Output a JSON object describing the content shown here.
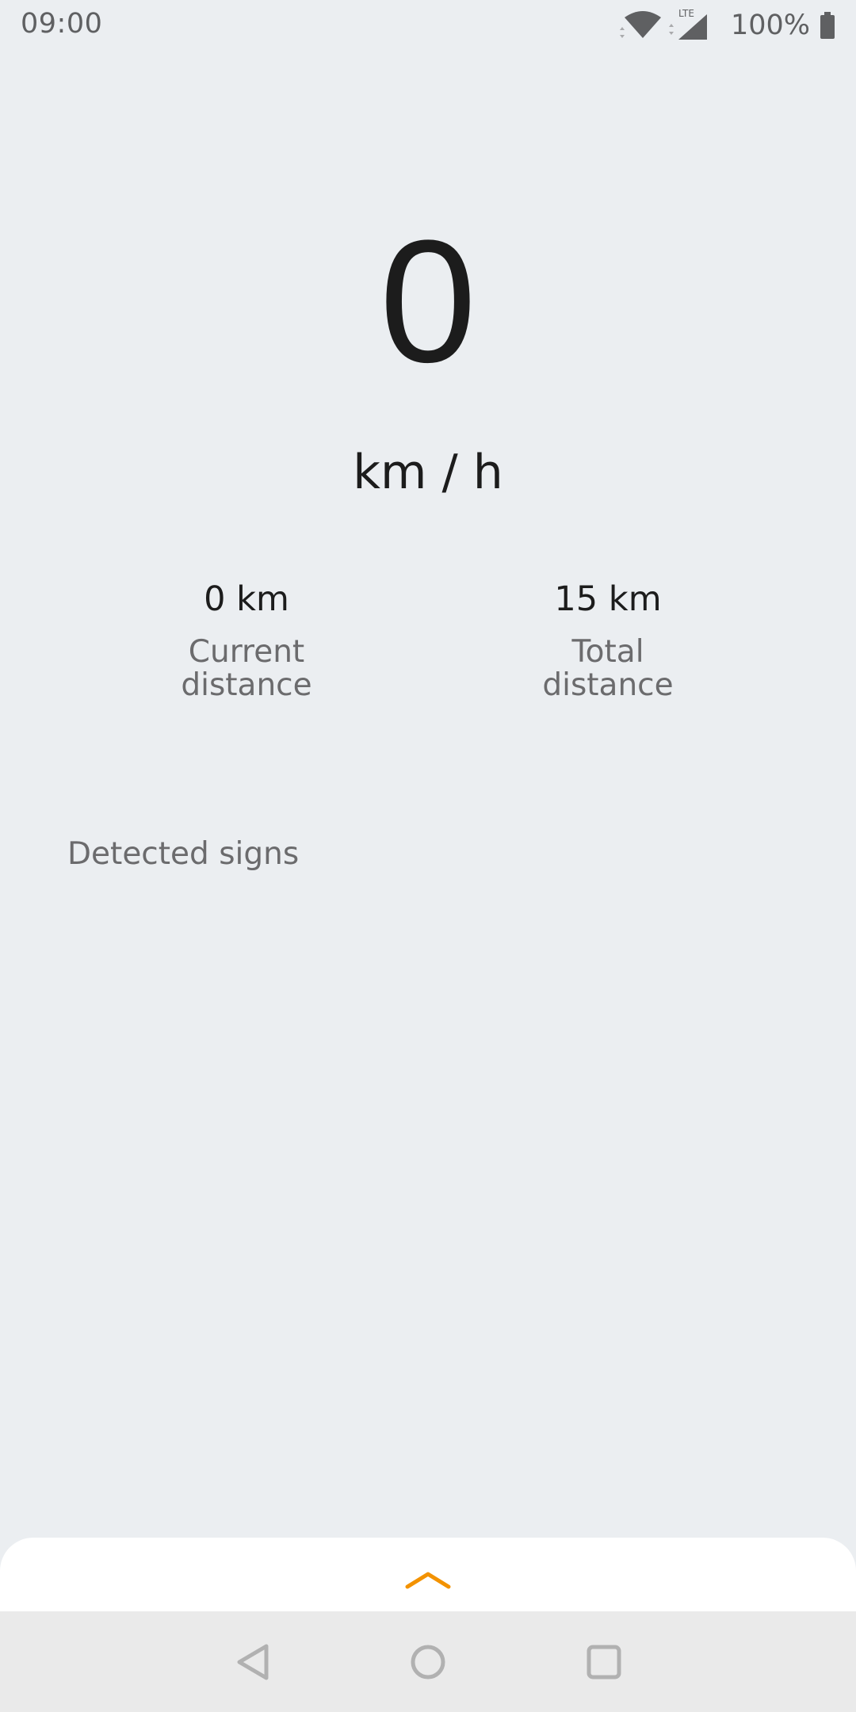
{
  "status_bar": {
    "time": "09:00",
    "network_type": "LTE",
    "battery_percent": "100%",
    "icons": [
      "wifi-icon",
      "signal-icon",
      "battery-icon"
    ]
  },
  "speedometer": {
    "speed": "0",
    "unit": "km / h"
  },
  "stats": {
    "current_distance_value": "0 km",
    "current_distance_label": "Current\ndistance",
    "total_distance_value": "15 km",
    "total_distance_label": "Total\ndistance"
  },
  "detected_signs": {
    "heading": "Detected signs"
  },
  "bottom_sheet": {
    "handle_icon": "chevron-up-icon",
    "accent_color": "#f39200"
  },
  "nav_bar": {
    "buttons": [
      "back-icon",
      "home-icon",
      "recents-icon"
    ]
  }
}
